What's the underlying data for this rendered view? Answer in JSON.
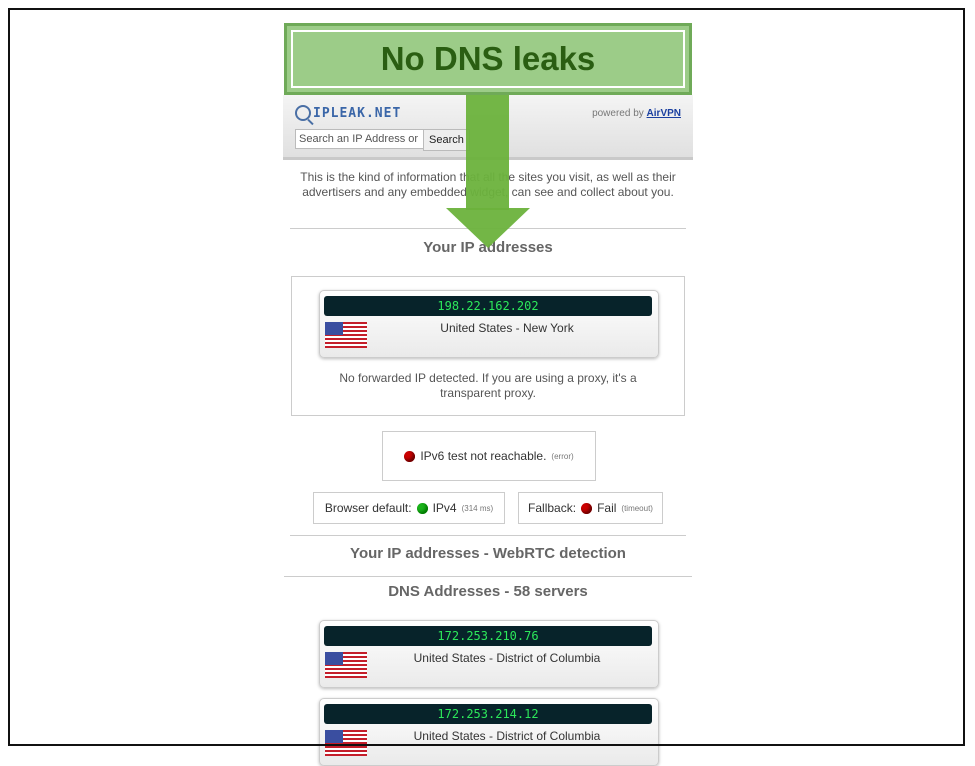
{
  "banner": {
    "text": "No DNS leaks"
  },
  "site": {
    "logo_text": "IPLEAK.NET",
    "powered_by": "powered by",
    "powered_link": "AirVPN",
    "search_placeholder": "Search an IP Address or",
    "search_button": "Search",
    "intro": "This is the kind of information that all the sites you visit, as well as their advertisers and any embedded widget, can see and collect about you."
  },
  "ip_section": {
    "title": "Your IP addresses",
    "ip": "198.22.162.202",
    "location": "United States - New York",
    "no_forward": "No forwarded IP detected. If you are using a proxy, it's a transparent proxy."
  },
  "ipv6": {
    "text": "IPv6 test not reachable.",
    "note": "(error)",
    "status_color": "#cc0000"
  },
  "browser_default": {
    "label": "Browser default:",
    "value": "IPv4",
    "note": "(314 ms)",
    "status_color": "#1bb31b"
  },
  "fallback": {
    "label": "Fallback:",
    "value": "Fail",
    "note": "(timeout)",
    "status_color": "#cc0000"
  },
  "webrtc": {
    "title": "Your IP addresses - WebRTC detection"
  },
  "dns": {
    "title": "DNS Addresses - 58 servers",
    "servers": [
      {
        "ip": "172.253.210.76",
        "location": "United States - District of Columbia"
      },
      {
        "ip": "172.253.214.12",
        "location": "United States - District of Columbia"
      }
    ]
  }
}
